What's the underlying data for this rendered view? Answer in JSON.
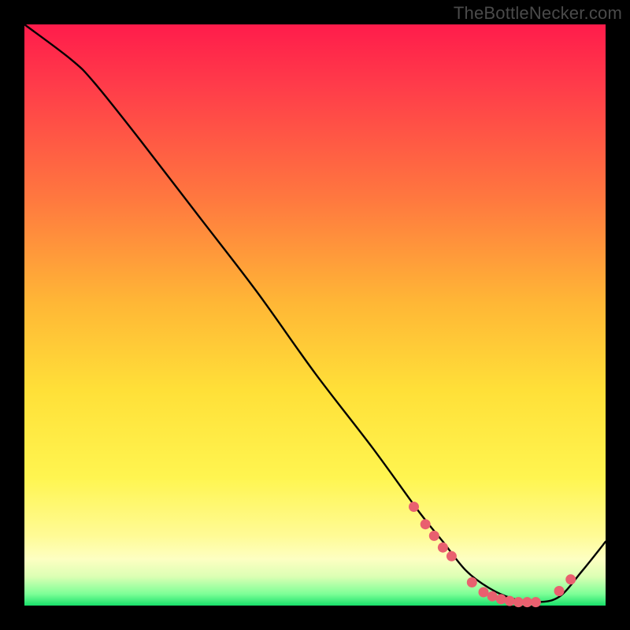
{
  "watermark": "TheBottleNecker.com",
  "chart_data": {
    "type": "line",
    "title": "",
    "xlabel": "",
    "ylabel": "",
    "xlim": [
      0,
      100
    ],
    "ylim": [
      0,
      100
    ],
    "series": [
      {
        "name": "bottleneck-curve",
        "x": [
          0,
          8,
          12,
          20,
          30,
          40,
          50,
          60,
          68,
          72,
          76,
          80,
          84,
          88,
          92,
          96,
          100
        ],
        "y": [
          100,
          94,
          90,
          80,
          67,
          54,
          40,
          27,
          16,
          11,
          6,
          3,
          1.2,
          0.6,
          1.5,
          6,
          11
        ]
      }
    ],
    "markers": {
      "name": "highlight-dots",
      "color": "#e9606f",
      "x": [
        67,
        69,
        70.5,
        72,
        73.5,
        77,
        79,
        80.5,
        82,
        83.5,
        85,
        86.5,
        88,
        92,
        94
      ],
      "y": [
        17,
        14,
        12,
        10,
        8.5,
        4,
        2.3,
        1.6,
        1.1,
        0.8,
        0.6,
        0.6,
        0.6,
        2.5,
        4.5
      ]
    }
  }
}
